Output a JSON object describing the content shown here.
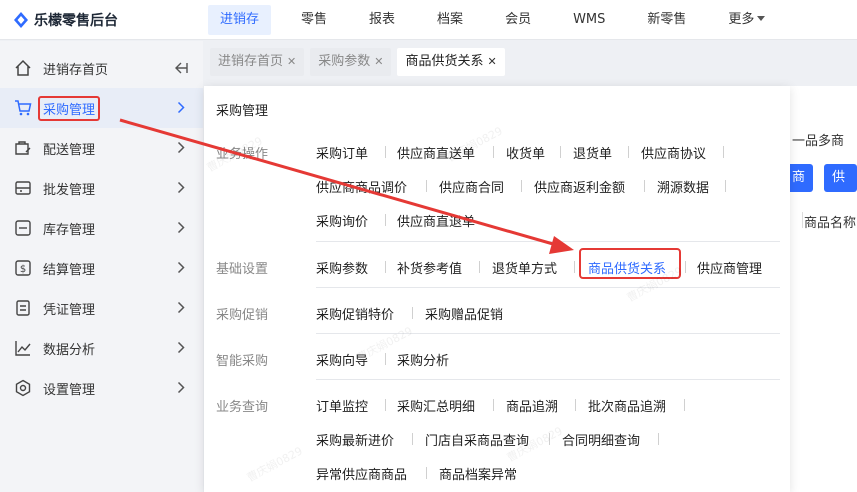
{
  "app": {
    "title": "乐檬零售后台"
  },
  "topnav": [
    {
      "label": "进销存",
      "active": true
    },
    {
      "label": "零售"
    },
    {
      "label": "报表"
    },
    {
      "label": "档案"
    },
    {
      "label": "会员"
    },
    {
      "label": "WMS"
    },
    {
      "label": "新零售"
    },
    {
      "label": "更多",
      "dropdown": true
    }
  ],
  "sidebar": {
    "items": [
      {
        "label": "进销存首页",
        "icon": "home-icon"
      },
      {
        "label": "采购管理",
        "icon": "cart-icon",
        "active": true
      },
      {
        "label": "配送管理",
        "icon": "delivery-icon"
      },
      {
        "label": "批发管理",
        "icon": "wholesale-icon"
      },
      {
        "label": "库存管理",
        "icon": "inventory-icon"
      },
      {
        "label": "结算管理",
        "icon": "settlement-icon"
      },
      {
        "label": "凭证管理",
        "icon": "voucher-icon"
      },
      {
        "label": "数据分析",
        "icon": "chart-icon"
      },
      {
        "label": "设置管理",
        "icon": "settings-icon"
      }
    ]
  },
  "tabs": [
    {
      "label": "进销存首页"
    },
    {
      "label": "采购参数"
    },
    {
      "label": "商品供货关系",
      "active": true
    }
  ],
  "background": {
    "text1": "一品多商",
    "btn1": "商",
    "btn2": "供货",
    "col_header": "商品名称"
  },
  "menu": {
    "title": "采购管理",
    "groups": {
      "ops": {
        "label": "业务操作",
        "row1": [
          "采购订单",
          "供应商直送单",
          "收货单",
          "退货单",
          "供应商协议"
        ],
        "row2": [
          "供应商商品调价",
          "供应商合同",
          "供应商返利金额",
          "溯源数据"
        ],
        "row3": [
          "采购询价",
          "供应商直退单"
        ]
      },
      "basic": {
        "label": "基础设置",
        "row1": [
          "采购参数",
          "补货参考值",
          "退货单方式",
          "商品供货关系",
          "供应商管理"
        ]
      },
      "promo": {
        "label": "采购促销",
        "row1": [
          "采购促销特价",
          "采购赠品促销"
        ]
      },
      "smart": {
        "label": "智能采购",
        "row1": [
          "采购向导",
          "采购分析"
        ]
      },
      "query": {
        "label": "业务查询",
        "row1": [
          "订单监控",
          "采购汇总明细",
          "商品追溯",
          "批次商品追溯"
        ],
        "row2": [
          "采购最新进价",
          "门店自采商品查询",
          "合同明细查询"
        ],
        "row3": [
          "异常供应商商品",
          "商品档案异常"
        ]
      }
    }
  },
  "watermark": "曹庆娟0829",
  "colors": {
    "accent": "#2f6bff",
    "annotation": "#e53935"
  }
}
